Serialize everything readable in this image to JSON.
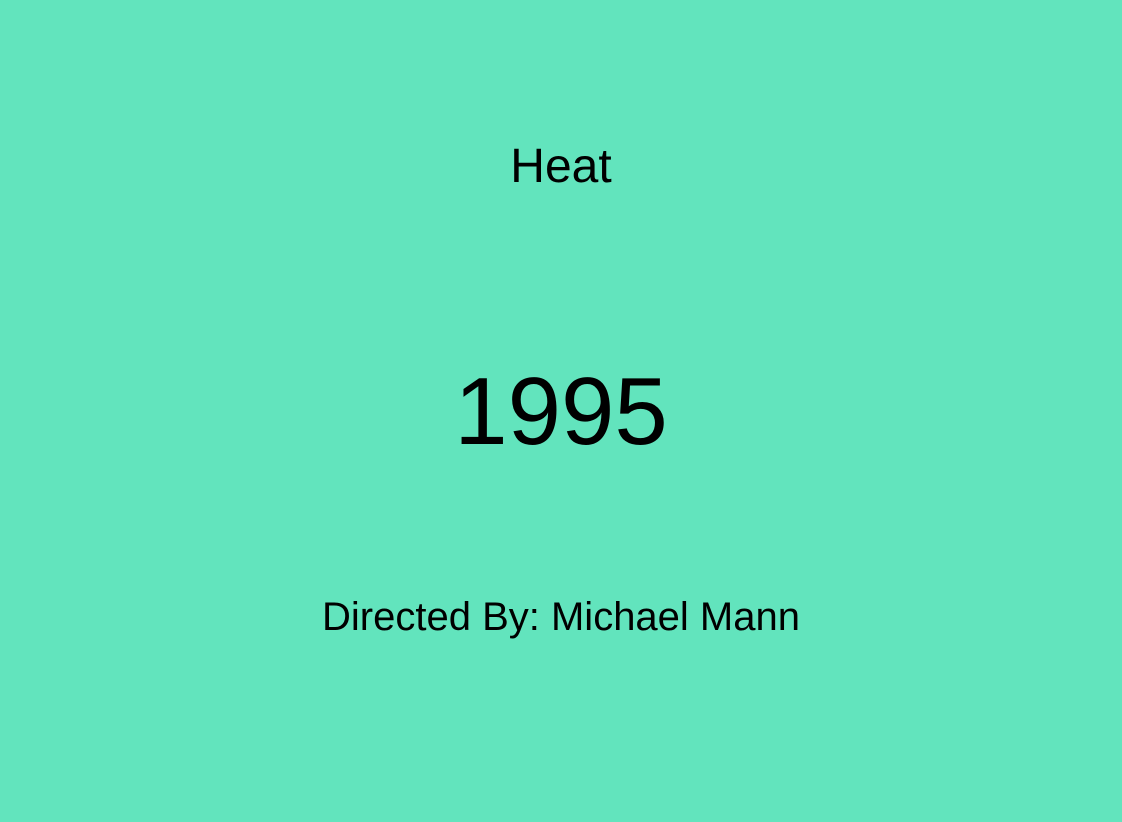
{
  "theme": {
    "background": "#62e4bd",
    "text_color": "#000000"
  },
  "movie": {
    "title": "Heat",
    "year": "1995",
    "director_line": "Directed By: Michael Mann"
  }
}
